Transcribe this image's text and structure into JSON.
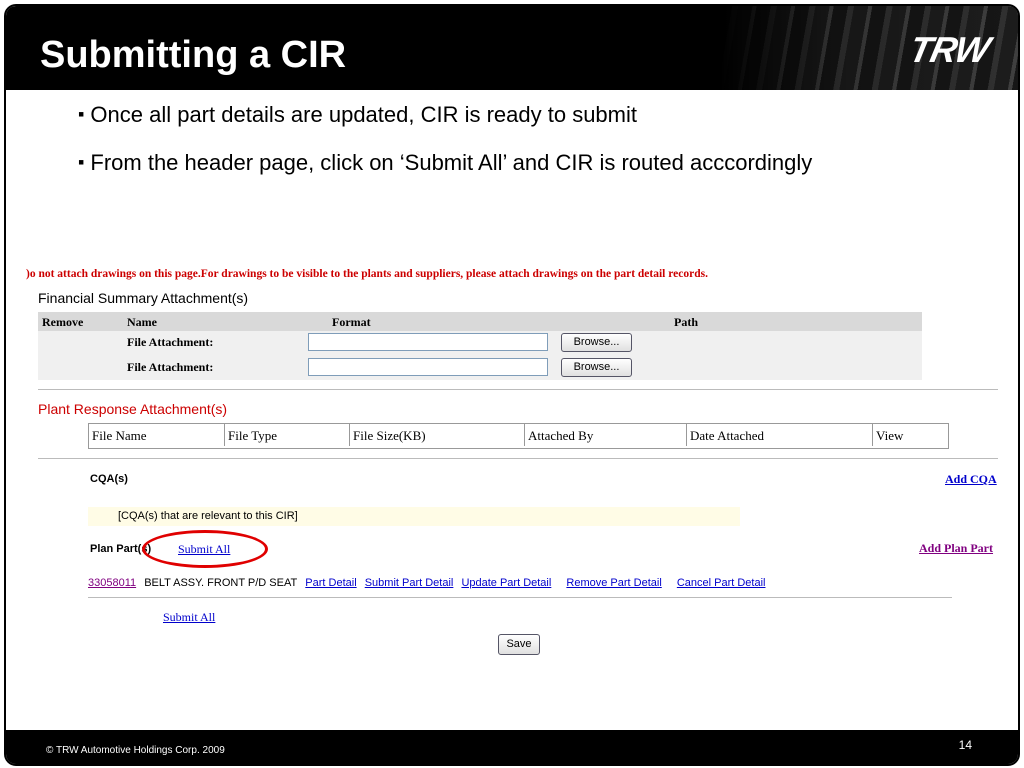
{
  "slide": {
    "title": "Submitting a CIR",
    "logo": "TRW",
    "bullets": [
      "Once all part details are updated, CIR is ready to submit",
      "From the header page, click on ‘Submit All’ and CIR is routed acccordingly"
    ],
    "footer": {
      "copyright": "© TRW Automotive Holdings Corp. 2009",
      "page_number": "14"
    }
  },
  "app": {
    "warning": ")o not attach drawings on this page.For drawings to be visible to the plants and suppliers, please attach drawings on the part detail records.",
    "financial": {
      "heading": "Financial Summary Attachment(s)",
      "columns": [
        "Remove",
        "Name",
        "Format",
        "Path"
      ],
      "rows": [
        {
          "label": "File Attachment:",
          "value": "",
          "button": "Browse..."
        },
        {
          "label": "File Attachment:",
          "value": "",
          "button": "Browse..."
        }
      ]
    },
    "plant_response": {
      "heading": "Plant Response Attachment(s)",
      "columns": [
        "File Name",
        "File Type",
        "File Size(KB)",
        "Attached By",
        "Date Attached",
        "View"
      ]
    },
    "cqa": {
      "label": "CQA(s)",
      "add_link": "Add CQA",
      "note": "[CQA(s) that are relevant to this CIR]"
    },
    "plan_parts": {
      "label": "Plan Part(s)",
      "submit_all": "Submit All",
      "add_link": "Add Plan Part",
      "row": {
        "part_number": "33058011",
        "description": "BELT ASSY. FRONT P/D SEAT",
        "links": [
          "Part Detail",
          "Submit Part Detail",
          "Update Part Detail",
          "Remove Part Detail",
          "Cancel Part Detail"
        ]
      },
      "submit_all_bottom": "Submit All"
    },
    "save_label": "Save"
  },
  "colors": {
    "title_bar": "#000000",
    "warning": "#cc0000",
    "link": "#0000cc",
    "visited_link": "#800080",
    "highlight": "#e00000"
  }
}
